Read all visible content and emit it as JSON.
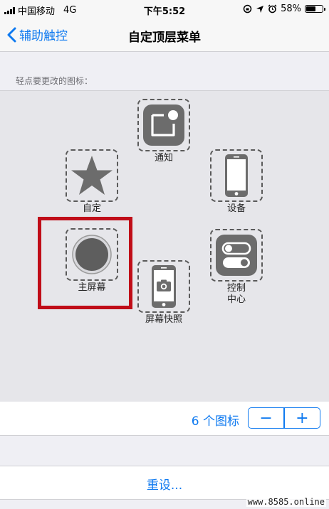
{
  "status_bar": {
    "carrier": "中国移动",
    "network": "4G",
    "time": "下午5:52",
    "battery_percent": "58%",
    "battery_level": 0.58,
    "icons": [
      "signal-icon",
      "lock-rotation-icon",
      "location-icon",
      "alarm-icon",
      "battery-icon"
    ]
  },
  "nav": {
    "back_label": "辅助触控",
    "title": "自定顶层菜单"
  },
  "section_label": "轻点要更改的图标：",
  "menu_items": {
    "notification": {
      "label": "通知",
      "icon": "notification-icon"
    },
    "custom": {
      "label": "自定",
      "icon": "star-icon"
    },
    "device": {
      "label": "设备",
      "icon": "iphone-icon"
    },
    "home": {
      "label": "主屏幕",
      "icon": "home-button-icon"
    },
    "control_center": {
      "label": "控制\n中心",
      "label_line1": "控制",
      "label_line2": "中心",
      "icon": "toggle-switches-icon"
    },
    "screenshot": {
      "label": "屏幕快照",
      "icon": "screenshot-icon"
    }
  },
  "count": {
    "text": "6 个图标",
    "minus": "−",
    "plus": "+"
  },
  "reset_label": "重设...",
  "watermark": "www.8585.online",
  "colors": {
    "accent": "#0f7af0",
    "highlight": "#c00d18",
    "icon_dark": "#6c6c6c"
  }
}
